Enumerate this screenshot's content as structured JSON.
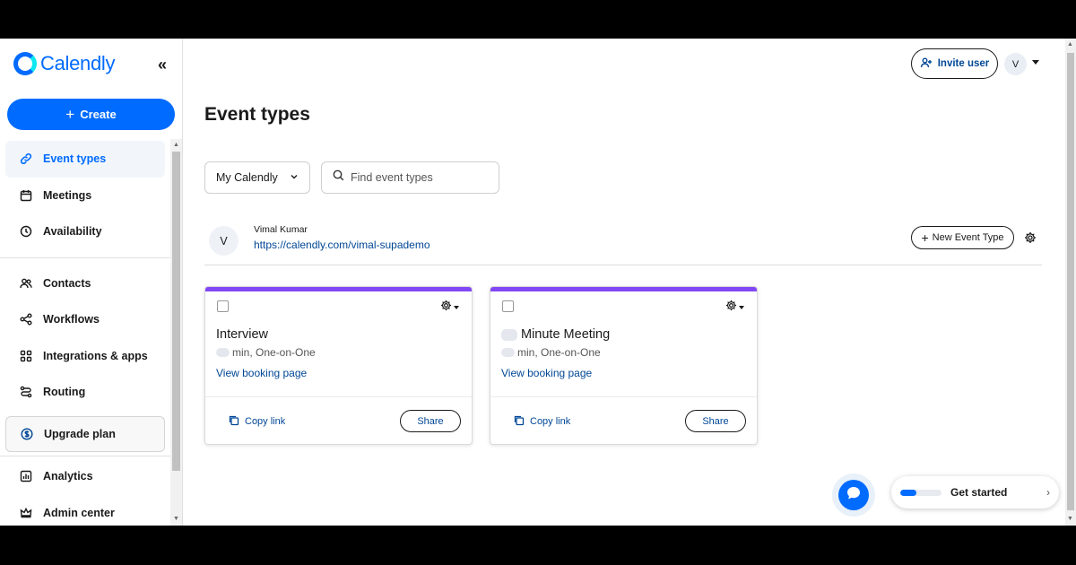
{
  "app": {
    "logo_text": "Calendly",
    "colors": {
      "brand": "#006bff",
      "card_accent": "#8247f5",
      "link": "#004796"
    }
  },
  "sidebar": {
    "collapse_icon": "chevron-double-left-icon",
    "create_label": "Create",
    "items": [
      {
        "label": "Event types",
        "icon": "link-icon",
        "active": true
      },
      {
        "label": "Meetings",
        "icon": "calendar-icon"
      },
      {
        "label": "Availability",
        "icon": "clock-icon"
      },
      {
        "label": "Contacts",
        "icon": "contacts-icon"
      },
      {
        "label": "Workflows",
        "icon": "workflow-icon"
      },
      {
        "label": "Integrations & apps",
        "icon": "grid-icon"
      },
      {
        "label": "Routing",
        "icon": "routing-icon"
      },
      {
        "label": "Upgrade plan",
        "icon": "dollar-icon"
      },
      {
        "label": "Analytics",
        "icon": "analytics-icon"
      },
      {
        "label": "Admin center",
        "icon": "crown-icon"
      }
    ]
  },
  "header": {
    "invite_label": "Invite user",
    "avatar_initial": "V"
  },
  "main": {
    "title": "Event types",
    "filter_selected": "My Calendly",
    "search_placeholder": "Find event types",
    "user": {
      "initial": "V",
      "name": "Vimal Kumar",
      "url": "https://calendly.com/vimal-supademo"
    },
    "new_event_label": "New Event Type",
    "cards": [
      {
        "title": "Interview",
        "meta": "min, One-on-One",
        "link": "View booking page",
        "copy": "Copy link",
        "share": "Share"
      },
      {
        "title": "Minute Meeting",
        "meta": "min, One-on-One",
        "link": "View booking page",
        "copy": "Copy link",
        "share": "Share"
      }
    ]
  },
  "widget": {
    "get_started_label": "Get started",
    "progress": 0.4
  }
}
